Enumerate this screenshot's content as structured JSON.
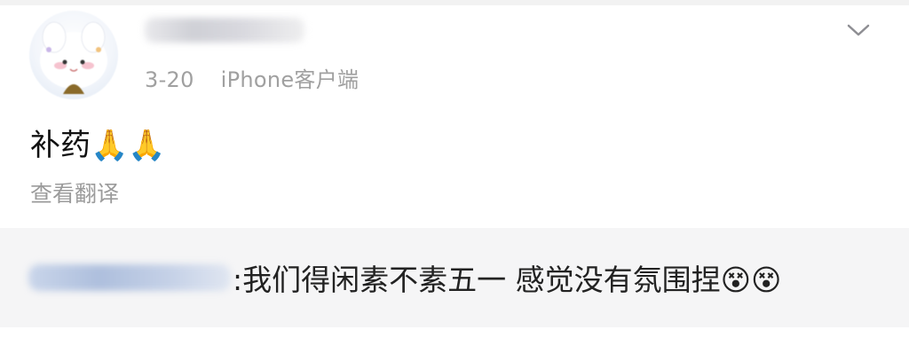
{
  "header": {
    "date": "3-20",
    "source": "iPhone客户端"
  },
  "post": {
    "text": "补药",
    "emoji": "🙏🙏",
    "translate_label": "查看翻译"
  },
  "repost": {
    "text": ":我们得闲素不素五一 感觉没有氛围捏",
    "emoji": "😵😵"
  },
  "icons": {
    "more": "chevron-down-icon"
  },
  "colors": {
    "meta_text": "#a0a0a0",
    "repost_bg": "#f5f5f6",
    "mention_blue": "#aebfdd"
  }
}
